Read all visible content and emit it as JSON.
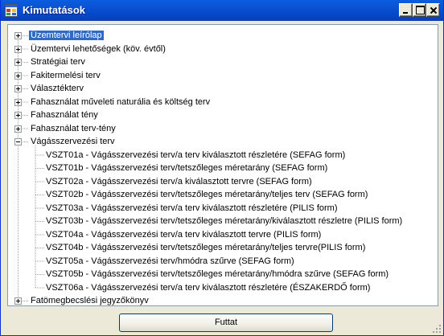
{
  "window": {
    "title": "Kimutatások"
  },
  "tree": {
    "nodes": [
      {
        "label": "Üzemtervi leírólap",
        "expanded": false,
        "selected": true
      },
      {
        "label": "Üzemtervi  lehetőségek (köv. évtől)",
        "expanded": false
      },
      {
        "label": "Stratégiai terv",
        "expanded": false
      },
      {
        "label": "Fakitermelési terv",
        "expanded": false
      },
      {
        "label": "Választékterv",
        "expanded": false
      },
      {
        "label": "Fahasználat műveleti naturália és költség terv",
        "expanded": false
      },
      {
        "label": "Fahasználat tény",
        "expanded": false
      },
      {
        "label": "Fahasználat terv-tény",
        "expanded": false
      },
      {
        "label": "Vágásszervezési terv",
        "expanded": true
      },
      {
        "label": "Fatömegbecslési jegyzőkönyv",
        "expanded": false
      }
    ],
    "children": [
      "VSZT01a - Vágásszervezési terv/a terv kiválasztott részletére (SEFAG form)",
      "VSZT01b - Vágásszervezési terv/tetszőleges méretarány (SEFAG form)",
      "VSZT02a - Vágásszervezési terv/a kiválasztott tervre (SEFAG form)",
      "VSZT02b - Vágásszervezési terv/tetszőleges méretarány/teljes terv  (SEFAG form)",
      "VSZT03a - Vágásszervezési terv/a terv kiválasztott részletére (PILIS form)",
      "VSZT03b - Vágásszervezési terv/tetszőleges méretarány/kiválasztott részletre (PILIS form)",
      "VSZT04a - Vágásszervezési terv/a terv kiválasztott tervre (PILIS form)",
      "VSZT04b - Vágásszervezési terv/tetszőleges méretarány/teljes tervre(PILIS form)",
      "VSZT05a - Vágásszervezési terv/hmódra szűrve (SEFAG form)",
      "VSZT05b - Vágásszervezési terv/tetszőleges méretarány/hmódra szűrve (SEFAG form)",
      "VSZT06a - Vágásszervezési terv/a terv kiválasztott részletére (ÉSZAKERDŐ form)"
    ]
  },
  "buttons": {
    "run_label": "Futtat"
  },
  "icons": {
    "app": "app-window-icon",
    "minimize": "minimize-icon",
    "maximize": "maximize-icon",
    "close": "close-icon"
  },
  "colors": {
    "titlebar": "#0a54d4",
    "selection": "#316ac5",
    "window_bg": "#ece9d8"
  }
}
